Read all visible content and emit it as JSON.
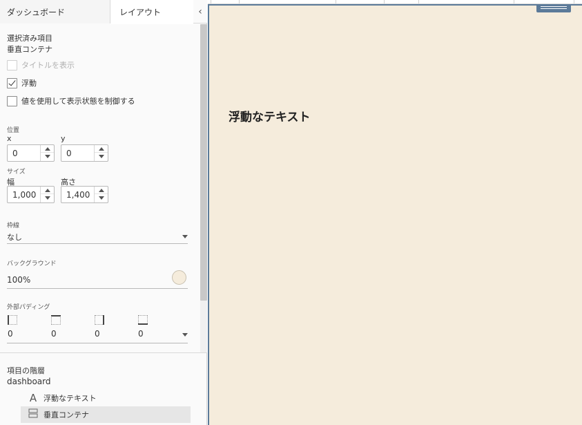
{
  "tabs": {
    "dashboard": "ダッシュボード",
    "layout": "レイアウト"
  },
  "selected": {
    "heading": "選択済み項目",
    "value": "垂直コンテナ"
  },
  "options": {
    "show_title": {
      "label": "タイトルを表示",
      "checked": false,
      "disabled": true
    },
    "floating": {
      "label": "浮動",
      "checked": true
    },
    "control_visibility": {
      "label": "値を使用して表示状態を制御する",
      "checked": false
    }
  },
  "position": {
    "heading": "位置",
    "x_label": "x",
    "x": "0",
    "y_label": "y",
    "y": "0"
  },
  "size": {
    "heading": "サイズ",
    "width_label": "幅",
    "width": "1,000",
    "height_label": "高さ",
    "height": "1,400"
  },
  "border": {
    "heading": "枠線",
    "value": "なし"
  },
  "background": {
    "heading": "バックグラウンド",
    "opacity": "100%",
    "color": "#f5ecdc"
  },
  "outer_padding": {
    "heading": "外部パディング",
    "left": "0",
    "top": "0",
    "right": "0",
    "bottom": "0"
  },
  "hierarchy": {
    "heading": "項目の階層",
    "root": "dashboard",
    "items": [
      {
        "icon": "text-icon",
        "glyph": "A",
        "label": "浮動なテキスト"
      },
      {
        "icon": "vertical-container-icon",
        "label": "垂直コンテナ"
      }
    ]
  },
  "canvas": {
    "text": "浮動なテキスト",
    "background": "#f5ecdc",
    "border_color": "#5b7a99"
  }
}
